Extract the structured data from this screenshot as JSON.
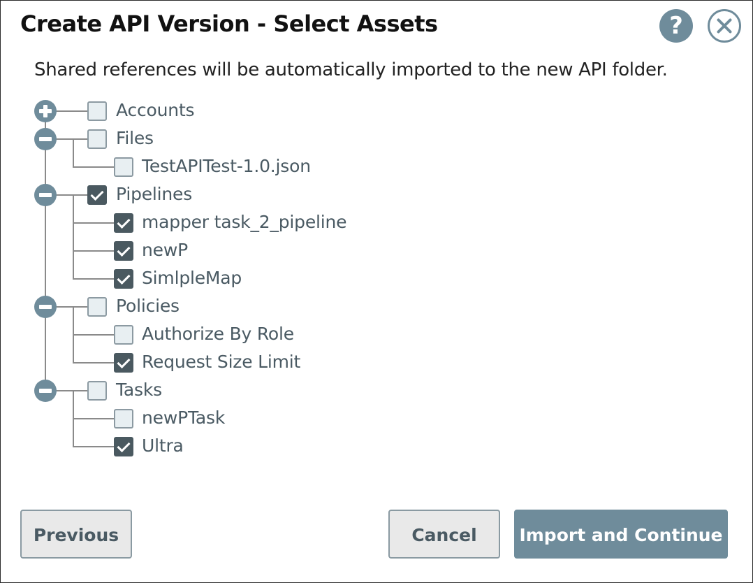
{
  "dialog": {
    "title": "Create API Version - Select Assets",
    "help_label": "?",
    "subtitle": "Shared references will be automatically imported to the new API folder."
  },
  "tree": {
    "groups": [
      {
        "label": "Accounts",
        "expanded": false,
        "checked": false,
        "children": []
      },
      {
        "label": "Files",
        "expanded": true,
        "checked": false,
        "children": [
          {
            "label": "TestAPITest-1.0.json",
            "checked": false
          }
        ]
      },
      {
        "label": "Pipelines",
        "expanded": true,
        "checked": true,
        "children": [
          {
            "label": "mapper task_2_pipeline",
            "checked": true
          },
          {
            "label": "newP",
            "checked": true
          },
          {
            "label": "SimlpleMap",
            "checked": true
          }
        ]
      },
      {
        "label": "Policies",
        "expanded": true,
        "checked": false,
        "children": [
          {
            "label": "Authorize By Role",
            "checked": false
          },
          {
            "label": "Request Size Limit",
            "checked": true
          }
        ]
      },
      {
        "label": "Tasks",
        "expanded": true,
        "checked": false,
        "children": [
          {
            "label": "newPTask",
            "checked": false
          },
          {
            "label": "Ultra",
            "checked": true
          }
        ]
      }
    ]
  },
  "footer": {
    "previous_label": "Previous",
    "cancel_label": "Cancel",
    "import_label": "Import and Continue"
  },
  "colors": {
    "accent": "#6f8c9b",
    "checked": "#4a5960",
    "label": "#4a5a63"
  }
}
